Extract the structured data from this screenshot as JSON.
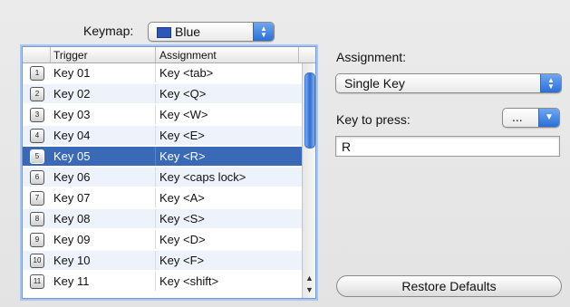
{
  "keymap": {
    "label": "Keymap:",
    "value": "Blue",
    "swatch_color": "#2c56b8"
  },
  "table": {
    "headers": [
      "Trigger",
      "Assignment"
    ],
    "rows": [
      {
        "icon": "1",
        "trigger": "Key 01",
        "assignment": "Key <tab>"
      },
      {
        "icon": "2",
        "trigger": "Key 02",
        "assignment": "Key <Q>"
      },
      {
        "icon": "3",
        "trigger": "Key 03",
        "assignment": "Key <W>"
      },
      {
        "icon": "4",
        "trigger": "Key 04",
        "assignment": "Key <E>"
      },
      {
        "icon": "5",
        "trigger": "Key 05",
        "assignment": "Key <R>"
      },
      {
        "icon": "6",
        "trigger": "Key 06",
        "assignment": "Key <caps lock>"
      },
      {
        "icon": "7",
        "trigger": "Key 07",
        "assignment": "Key <A>"
      },
      {
        "icon": "8",
        "trigger": "Key 08",
        "assignment": "Key <S>"
      },
      {
        "icon": "9",
        "trigger": "Key 09",
        "assignment": "Key <D>"
      },
      {
        "icon": "10",
        "trigger": "Key 10",
        "assignment": "Key <F>"
      },
      {
        "icon": "11",
        "trigger": "Key 11",
        "assignment": "Key <shift>"
      }
    ],
    "selected_row": "Key 05",
    "selection_color": "#3a6ab7"
  },
  "assignment": {
    "label": "Assignment:",
    "value": "Single Key"
  },
  "key_to_press": {
    "label": "Key to press:",
    "menu_value": "...",
    "field_value": "R"
  },
  "restore_button": {
    "label": "Restore Defaults"
  }
}
